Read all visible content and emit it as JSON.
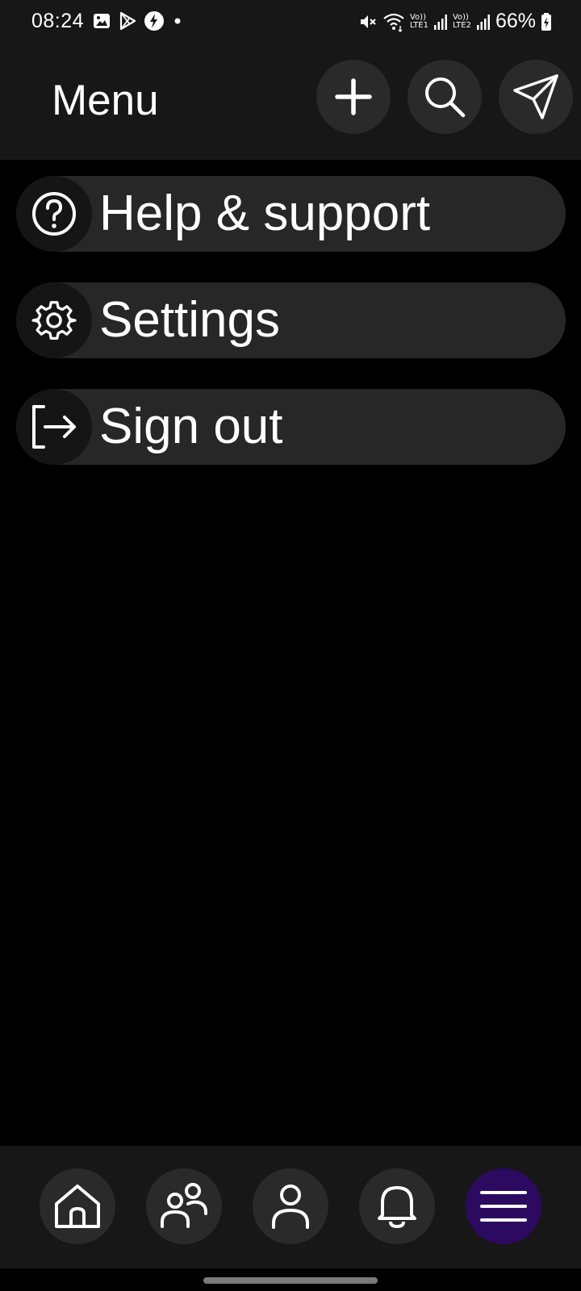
{
  "status_bar": {
    "time": "08:24",
    "battery": "66%",
    "sim1_top": "Vo))",
    "sim1_bottom": "LTE1",
    "sim2_top": "Vo))",
    "sim2_bottom": "LTE2",
    "left_icons": [
      "gallery-icon",
      "play-store-icon",
      "flash-app-icon",
      "dot-icon"
    ],
    "right_icons": [
      "mute-icon",
      "wifi-icon",
      "signal-icon",
      "signal-icon",
      "battery-charging-icon"
    ]
  },
  "header": {
    "title": "Menu",
    "actions": [
      {
        "icon": "plus-icon"
      },
      {
        "icon": "search-icon"
      },
      {
        "icon": "send-icon"
      }
    ]
  },
  "menu": {
    "items": [
      {
        "label": "Help & support",
        "icon": "help-circle-icon"
      },
      {
        "label": "Settings",
        "icon": "gear-icon"
      },
      {
        "label": "Sign out",
        "icon": "sign-out-icon"
      }
    ]
  },
  "bottom_nav": {
    "items": [
      {
        "icon": "home-icon",
        "active": false
      },
      {
        "icon": "friends-icon",
        "active": false
      },
      {
        "icon": "profile-icon",
        "active": false
      },
      {
        "icon": "bell-icon",
        "active": false
      },
      {
        "icon": "menu-icon",
        "active": true
      }
    ],
    "active_color": "#2b0a5f"
  },
  "colors": {
    "background": "#000000",
    "bar": "#171717",
    "item": "#272727",
    "accent": "#2b0a5f"
  }
}
